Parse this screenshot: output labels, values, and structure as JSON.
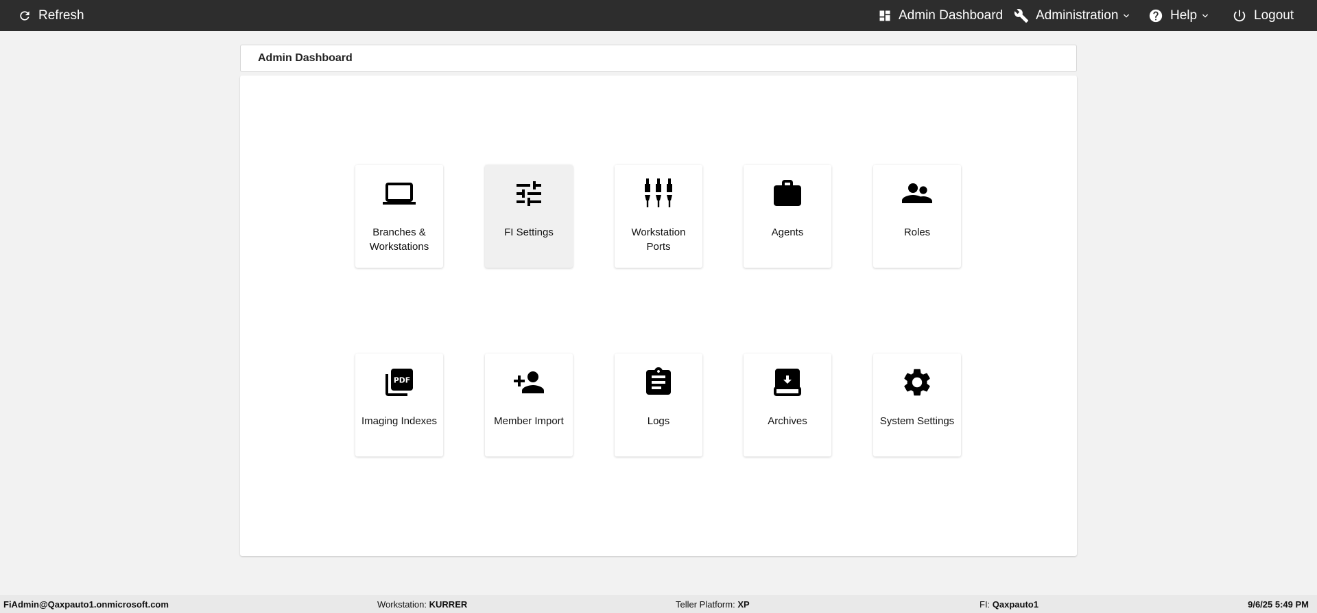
{
  "topbar": {
    "refresh_label": "Refresh",
    "admin_dashboard_label": "Admin Dashboard",
    "administration_label": "Administration",
    "help_label": "Help",
    "logout_label": "Logout"
  },
  "page": {
    "title": "Admin Dashboard"
  },
  "tiles": [
    {
      "label": "Branches & Workstations",
      "icon": "laptop-icon"
    },
    {
      "label": "FI Settings",
      "icon": "sliders-icon"
    },
    {
      "label": "Workstation Ports",
      "icon": "ports-icon"
    },
    {
      "label": "Agents",
      "icon": "briefcase-icon"
    },
    {
      "label": "Roles",
      "icon": "people-icon"
    },
    {
      "label": "Imaging Indexes",
      "icon": "pdf-icon"
    },
    {
      "label": "Member Import",
      "icon": "person-add-icon"
    },
    {
      "label": "Logs",
      "icon": "clipboard-icon"
    },
    {
      "label": "Archives",
      "icon": "archive-icon"
    },
    {
      "label": "System Settings",
      "icon": "gear-icon"
    }
  ],
  "statusbar": {
    "user": "FiAdmin@Qaxpauto1.onmicrosoft.com",
    "workstation_label": "Workstation:",
    "workstation_value": "KURRER",
    "platform_label": "Teller Platform:",
    "platform_value": "XP",
    "fi_label": "FI:",
    "fi_value": "Qaxpauto1",
    "datetime": "9/6/25 5:49 PM"
  },
  "colors": {
    "topbar_bg": "#2d2d2d",
    "page_bg": "#f2f2f2",
    "active_tile_bg": "#f0f0f0"
  }
}
